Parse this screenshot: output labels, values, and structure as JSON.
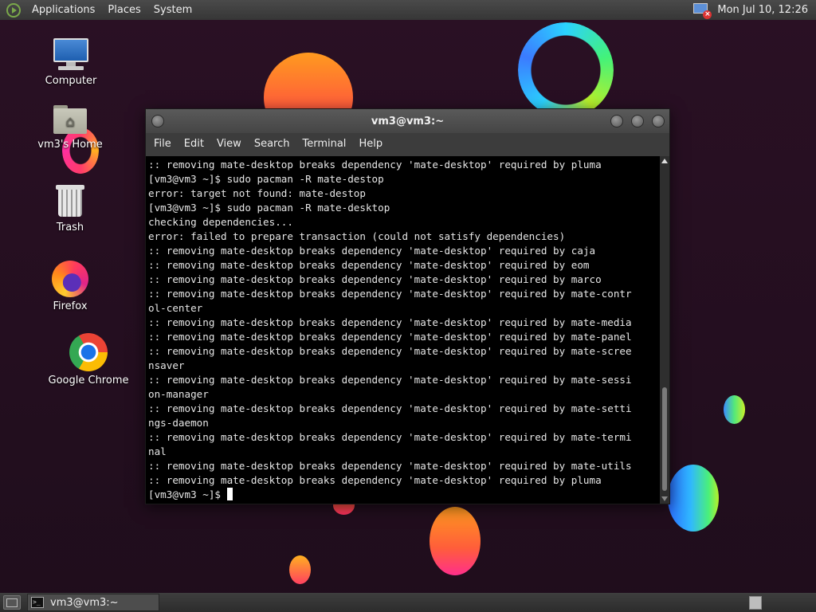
{
  "top_panel": {
    "menus": [
      "Applications",
      "Places",
      "System"
    ],
    "clock": "Mon Jul 10, 12:26"
  },
  "desktop_icons": [
    {
      "label": "Computer",
      "icon": "computer-icon"
    },
    {
      "label": "vm3's Home",
      "icon": "home-folder-icon"
    },
    {
      "label": "Trash",
      "icon": "trash-icon"
    },
    {
      "label": "Firefox",
      "icon": "firefox-icon"
    },
    {
      "label": "Google Chrome",
      "icon": "chrome-icon"
    }
  ],
  "window": {
    "title": "vm3@vm3:~",
    "menus": [
      "File",
      "Edit",
      "View",
      "Search",
      "Terminal",
      "Help"
    ],
    "terminal_lines": [
      ":: removing mate-desktop breaks dependency 'mate-desktop' required by pluma",
      "[vm3@vm3 ~]$ sudo pacman -R mate-destop",
      "error: target not found: mate-destop",
      "[vm3@vm3 ~]$ sudo pacman -R mate-desktop",
      "checking dependencies...",
      "error: failed to prepare transaction (could not satisfy dependencies)",
      ":: removing mate-desktop breaks dependency 'mate-desktop' required by caja",
      ":: removing mate-desktop breaks dependency 'mate-desktop' required by eom",
      ":: removing mate-desktop breaks dependency 'mate-desktop' required by marco",
      ":: removing mate-desktop breaks dependency 'mate-desktop' required by mate-contr",
      "ol-center",
      ":: removing mate-desktop breaks dependency 'mate-desktop' required by mate-media",
      ":: removing mate-desktop breaks dependency 'mate-desktop' required by mate-panel",
      ":: removing mate-desktop breaks dependency 'mate-desktop' required by mate-scree",
      "nsaver",
      ":: removing mate-desktop breaks dependency 'mate-desktop' required by mate-sessi",
      "on-manager",
      ":: removing mate-desktop breaks dependency 'mate-desktop' required by mate-setti",
      "ngs-daemon",
      ":: removing mate-desktop breaks dependency 'mate-desktop' required by mate-termi",
      "nal",
      ":: removing mate-desktop breaks dependency 'mate-desktop' required by mate-utils",
      ":: removing mate-desktop breaks dependency 'mate-desktop' required by pluma"
    ],
    "prompt": "[vm3@vm3 ~]$ "
  },
  "taskbar": {
    "task_label": "vm3@vm3:~"
  }
}
